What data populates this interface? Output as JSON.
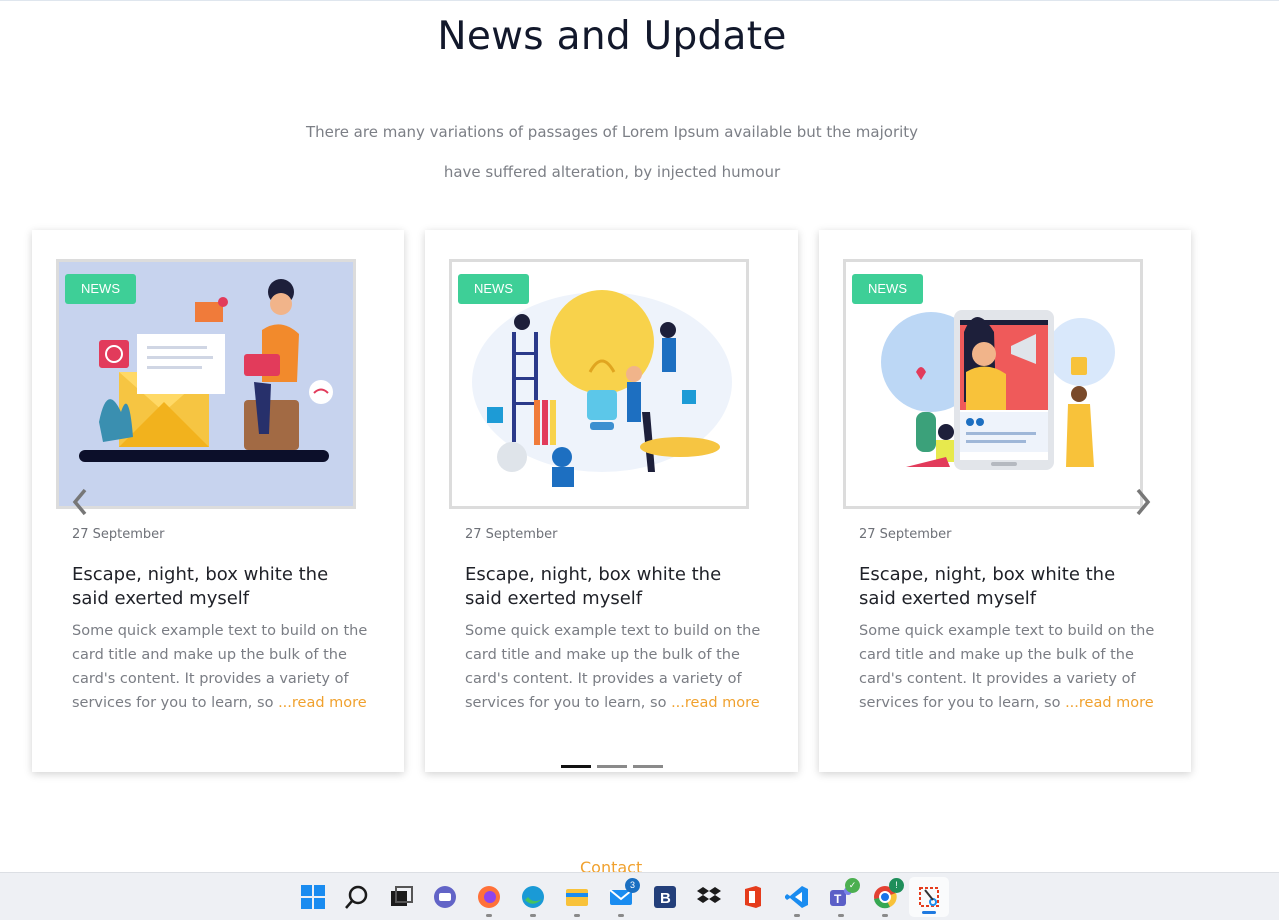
{
  "section": {
    "title": "News and Update",
    "subtitle": "There are many variations of passages of Lorem Ipsum available but the majority have suffered alteration, by injected humour"
  },
  "cards": [
    {
      "badge": "NEWS",
      "date": "27 September",
      "title": "Escape, night, box white the said exerted myself",
      "desc": "Some quick example text to build on the card title and make up the bulk of the card's content. It provides a variety of services for you to learn, so ",
      "more": "...read more"
    },
    {
      "badge": "NEWS",
      "date": "27 September",
      "title": "Escape, night, box white the said exerted myself",
      "desc": "Some quick example text to build on the card title and make up the bulk of the card's content. It provides a variety of services for you to learn, so ",
      "more": "...read more"
    },
    {
      "badge": "NEWS",
      "date": "27 September",
      "title": "Escape, night, box white the said exerted myself",
      "desc": "Some quick example text to build on the card title and make up the bulk of the card's content. It provides a variety of services for you to learn, so ",
      "more": "...read more"
    }
  ],
  "carousel": {
    "active_index": 0,
    "page_count": 3
  },
  "footer_peek": "Contact",
  "taskbar": {
    "icons": [
      "windows-start-icon",
      "search-icon",
      "task-view-icon",
      "teams-chat-icon",
      "firefox-icon",
      "edge-icon",
      "file-explorer-icon",
      "mail-icon",
      "bootstrap-studio-icon",
      "dropbox-icon",
      "office-icon",
      "vscode-icon",
      "teams-icon",
      "chrome-icon",
      "snipping-tool-icon"
    ],
    "mail_badge": "3",
    "chrome_badge": "!"
  },
  "colors": {
    "accent": "#f0a12e",
    "badge": "#3ecf97",
    "title": "#12182b"
  }
}
